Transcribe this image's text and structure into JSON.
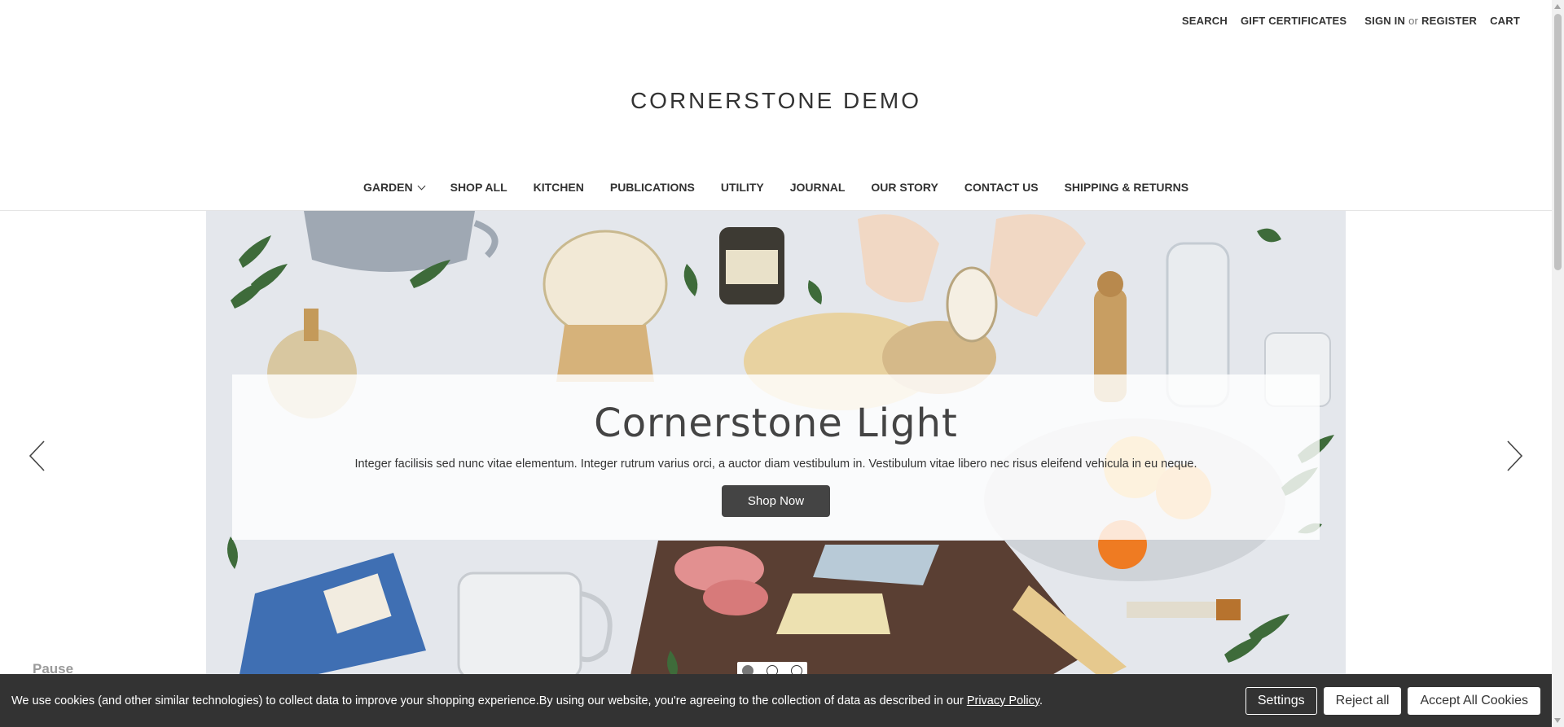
{
  "utility": {
    "search": "SEARCH",
    "gift": "GIFT CERTIFICATES",
    "sign_in": "SIGN IN",
    "or": "or",
    "register": "REGISTER",
    "cart": "CART"
  },
  "logo": "CORNERSTONE DEMO",
  "nav": {
    "items": [
      {
        "label": "GARDEN"
      },
      {
        "label": "SHOP ALL"
      },
      {
        "label": "KITCHEN"
      },
      {
        "label": "PUBLICATIONS"
      },
      {
        "label": "UTILITY"
      },
      {
        "label": "JOURNAL"
      },
      {
        "label": "OUR STORY"
      },
      {
        "label": "CONTACT US"
      },
      {
        "label": "SHIPPING & RETURNS"
      }
    ]
  },
  "hero": {
    "title": "Cornerstone Light",
    "text": "Integer facilisis sed nunc vitae elementum. Integer rutrum varius orci, a auctor diam vestibulum in. Vestibulum vitae libero nec risus eleifend vehicula in eu neque.",
    "button": "Shop Now",
    "slides": 3,
    "active_slide": 1
  },
  "pause": "Pause",
  "cookie": {
    "text": "We use cookies (and other similar technologies) to collect data to improve your shopping experience.By using our website, you're agreeing to the collection of data as described in our ",
    "link": "Privacy Policy",
    "end": ".",
    "settings": "Settings",
    "reject": "Reject all",
    "accept": "Accept All Cookies"
  },
  "colors": {
    "text": "#333333",
    "banner": "#333333",
    "button_dark": "#444444"
  }
}
